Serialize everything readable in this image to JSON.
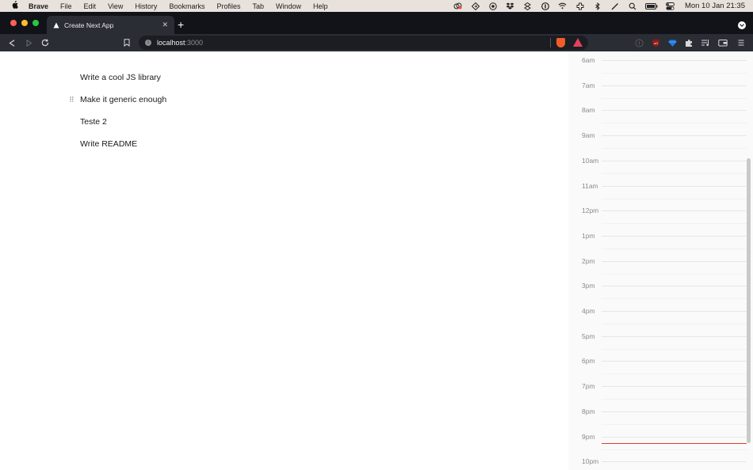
{
  "menubar": {
    "apple": "",
    "items": [
      "Brave",
      "File",
      "Edit",
      "View",
      "History",
      "Bookmarks",
      "Profiles",
      "Tab",
      "Window",
      "Help"
    ],
    "clock": "Mon 10 Jan  21:35"
  },
  "browser": {
    "tab_title": "Create Next App",
    "tab_close": "✕",
    "new_tab": "+",
    "url_host": "localhost",
    "url_port": ":3000"
  },
  "todos": [
    "Write a cool JS library",
    "Make it generic enough",
    "Teste 2",
    "Write README"
  ],
  "calendar": {
    "hours": [
      "6am",
      "7am",
      "8am",
      "9am",
      "10am",
      "11am",
      "12pm",
      "1pm",
      "2pm",
      "3pm",
      "4pm",
      "5pm",
      "6pm",
      "7pm",
      "8pm",
      "9pm",
      "10pm"
    ],
    "current_time_color": "#d9412b"
  },
  "icons": {
    "back": "◀",
    "forward": "▷",
    "reload": "↻",
    "bookmark": "⌑",
    "drag": "⠿"
  }
}
